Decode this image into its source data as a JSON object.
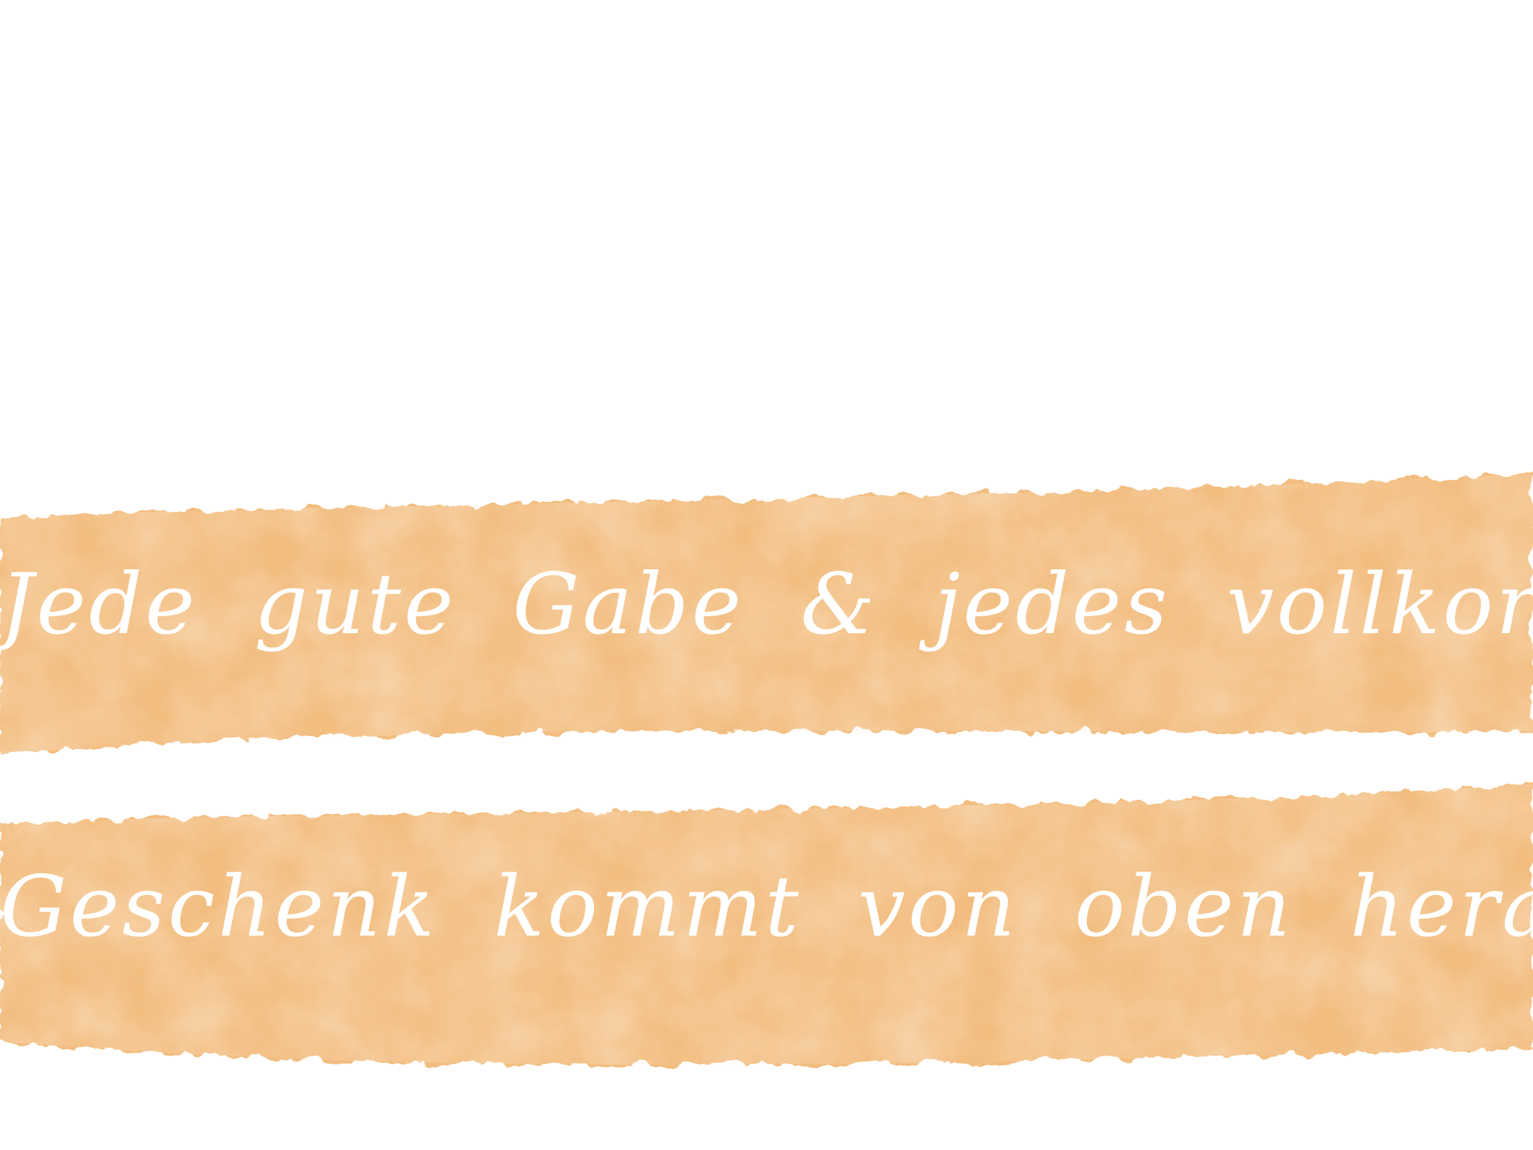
{
  "colors": {
    "background": "#ffffff",
    "band": "#f2bd7f",
    "band_light": "#f6cf9c",
    "band_dark": "#eab271",
    "text": "#ffffff"
  },
  "lettering": {
    "line1": "Jede gute Gabe & jedes vollkommene",
    "line2": "Geschenk kommt von oben herab!"
  }
}
